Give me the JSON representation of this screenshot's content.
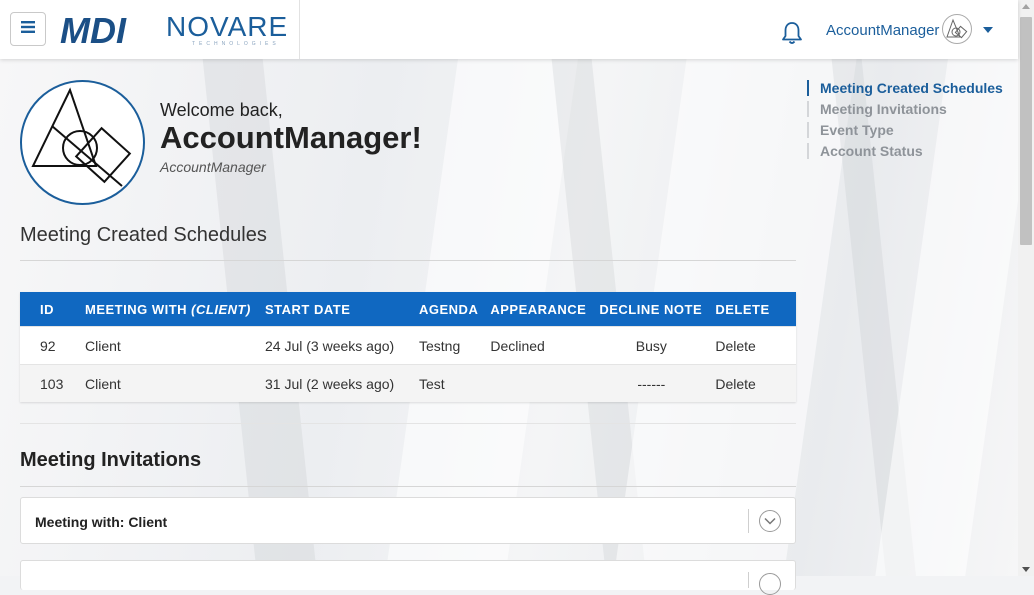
{
  "header": {
    "brand_mdi": "MDI",
    "brand_novare": "NOVARE",
    "brand_tagline": "TECHNOLOGIES",
    "user_name": "AccountManager"
  },
  "profile": {
    "welcome": "Welcome back,",
    "display_name": "AccountManager!",
    "username": "AccountManager"
  },
  "toc": {
    "items": [
      {
        "label": "Meeting Created Schedules",
        "active": true
      },
      {
        "label": "Meeting Invitations",
        "active": false
      },
      {
        "label": "Event Type",
        "active": false
      },
      {
        "label": "Account Status",
        "active": false
      }
    ]
  },
  "schedules": {
    "title": "Meeting Created Schedules",
    "columns": {
      "id": "ID",
      "meeting_with": "MEETING WITH",
      "meeting_with_sub": "(CLIENT)",
      "start_date": "START DATE",
      "agenda": "AGENDA",
      "appearance": "APPEARANCE",
      "decline_note": "DECLINE NOTE",
      "delete": "DELETE"
    },
    "rows": [
      {
        "id": "92",
        "meeting_with": "Client",
        "start_date": "24 Jul (3 weeks ago)",
        "agenda": "Testng",
        "appearance": "Declined",
        "decline_note": "Busy",
        "delete": "Delete"
      },
      {
        "id": "103",
        "meeting_with": "Client",
        "start_date": "31 Jul (2 weeks ago)",
        "agenda": "Test",
        "appearance": "",
        "decline_note": "------",
        "delete": "Delete"
      }
    ]
  },
  "invitations": {
    "title": "Meeting Invitations",
    "items": [
      {
        "label": "Meeting with: Client"
      }
    ]
  },
  "colors": {
    "primary": "#1068c1",
    "brand": "#1b5e9b",
    "danger": "#d32323"
  },
  "icons": {
    "menu": "hamburger-icon",
    "bell": "bell-icon",
    "caret": "caret-down-icon",
    "chevron": "chevron-down-icon"
  }
}
